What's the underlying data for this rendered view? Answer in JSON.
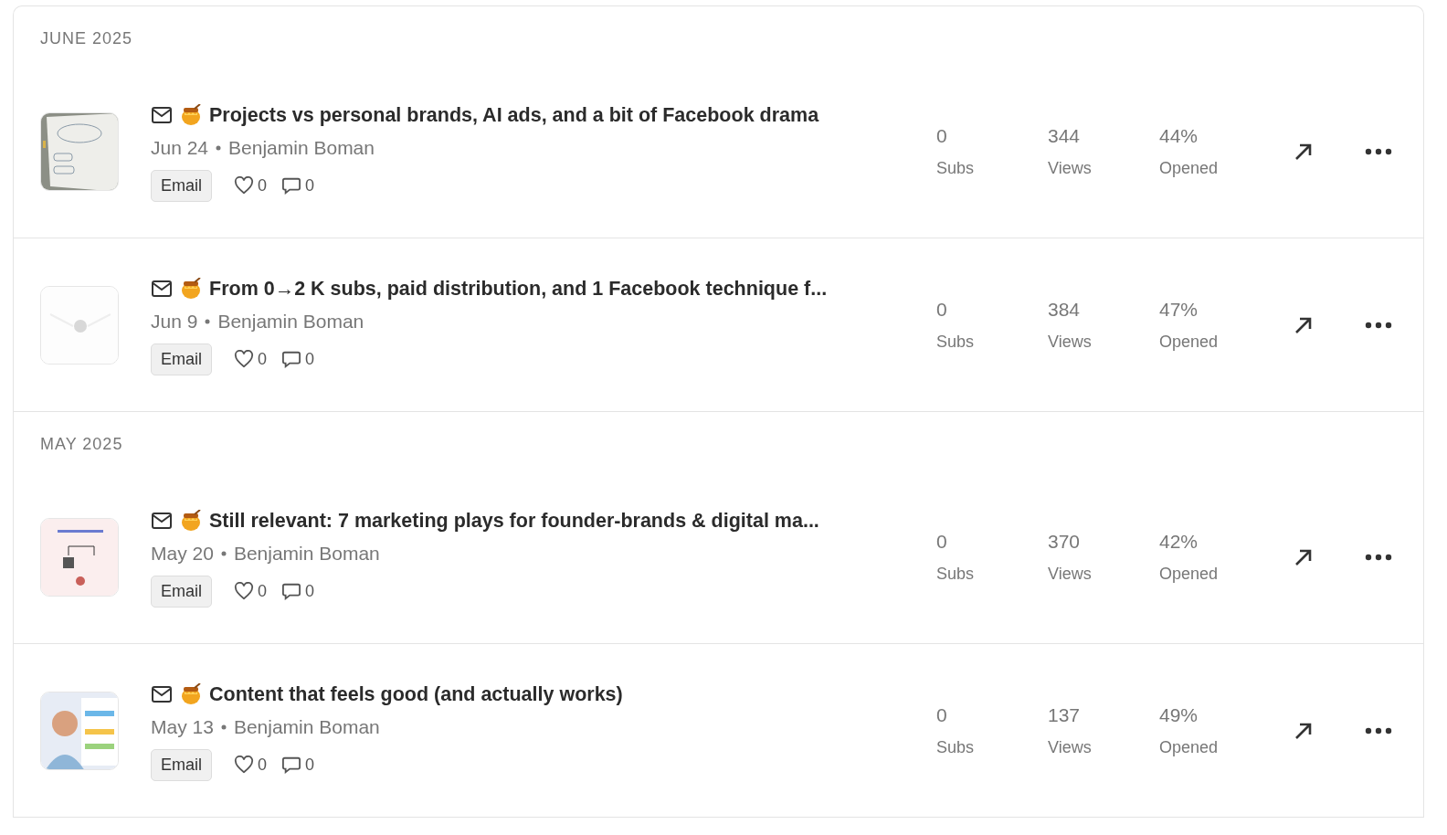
{
  "sections": [
    {
      "heading": "JUNE 2025",
      "posts": [
        {
          "title": "Projects vs personal brands, AI ads, and a bit of Facebook drama",
          "date": "Jun 24",
          "author": "Benjamin Boman",
          "tag": "Email",
          "likes": "0",
          "comments": "0",
          "stats": [
            {
              "value": "0",
              "label": "Subs"
            },
            {
              "value": "344",
              "label": "Views"
            },
            {
              "value": "44%",
              "label": "Opened"
            }
          ]
        },
        {
          "title": "From 0→2 K subs, paid distribution, and 1 Facebook technique f...",
          "date": "Jun 9",
          "author": "Benjamin Boman",
          "tag": "Email",
          "likes": "0",
          "comments": "0",
          "stats": [
            {
              "value": "0",
              "label": "Subs"
            },
            {
              "value": "384",
              "label": "Views"
            },
            {
              "value": "47%",
              "label": "Opened"
            }
          ]
        }
      ]
    },
    {
      "heading": "MAY 2025",
      "posts": [
        {
          "title": "Still relevant: 7 marketing plays for founder-brands & digital ma...",
          "date": "May 20",
          "author": "Benjamin Boman",
          "tag": "Email",
          "likes": "0",
          "comments": "0",
          "stats": [
            {
              "value": "0",
              "label": "Subs"
            },
            {
              "value": "370",
              "label": "Views"
            },
            {
              "value": "42%",
              "label": "Opened"
            }
          ]
        },
        {
          "title": "Content that feels good (and actually works)",
          "date": "May 13",
          "author": "Benjamin Boman",
          "tag": "Email",
          "likes": "0",
          "comments": "0",
          "stats": [
            {
              "value": "0",
              "label": "Subs"
            },
            {
              "value": "137",
              "label": "Views"
            },
            {
              "value": "49%",
              "label": "Opened"
            }
          ]
        }
      ]
    }
  ]
}
